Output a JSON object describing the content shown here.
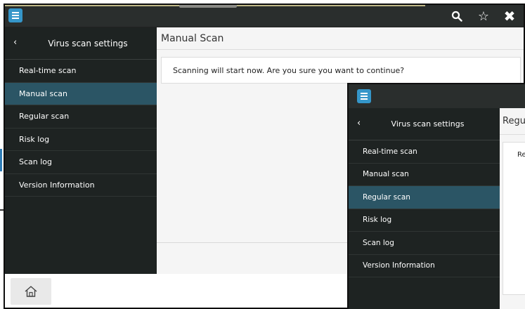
{
  "colors": {
    "accent": "#3596c9",
    "sidebar_bg": "#1e2322",
    "active_item": "#2b5565",
    "content_bg": "#f5f5f5"
  },
  "main_window": {
    "topbar": {
      "menu_icon": "hamburger-menu-icon",
      "icons": [
        "search-icon",
        "star-icon",
        "close-icon"
      ]
    },
    "sidebar": {
      "title": "Virus scan settings",
      "back_icon": "chevron-left-icon",
      "items": [
        {
          "label": "Real-time scan",
          "active": false
        },
        {
          "label": "Manual scan",
          "active": true
        },
        {
          "label": "Regular scan",
          "active": false
        },
        {
          "label": "Risk log",
          "active": false
        },
        {
          "label": "Scan log",
          "active": false
        },
        {
          "label": "Version Information",
          "active": false
        }
      ]
    },
    "content": {
      "title": "Manual Scan",
      "message": "Scanning will start now. Are you sure you want to continue?"
    },
    "bottombar": {
      "home_icon": "home-icon"
    }
  },
  "overlay_window": {
    "topbar": {
      "menu_icon": "hamburger-menu-icon"
    },
    "sidebar": {
      "title": "Virus scan settings",
      "back_icon": "chevron-left-icon",
      "items": [
        {
          "label": "Real-time scan",
          "active": false
        },
        {
          "label": "Manual scan",
          "active": false
        },
        {
          "label": "Regular scan",
          "active": true
        },
        {
          "label": "Risk log",
          "active": false
        },
        {
          "label": "Scan log",
          "active": false
        },
        {
          "label": "Version Information",
          "active": false
        }
      ]
    },
    "content": {
      "title_partial": "Regu",
      "box_text_partial": "Re"
    }
  }
}
